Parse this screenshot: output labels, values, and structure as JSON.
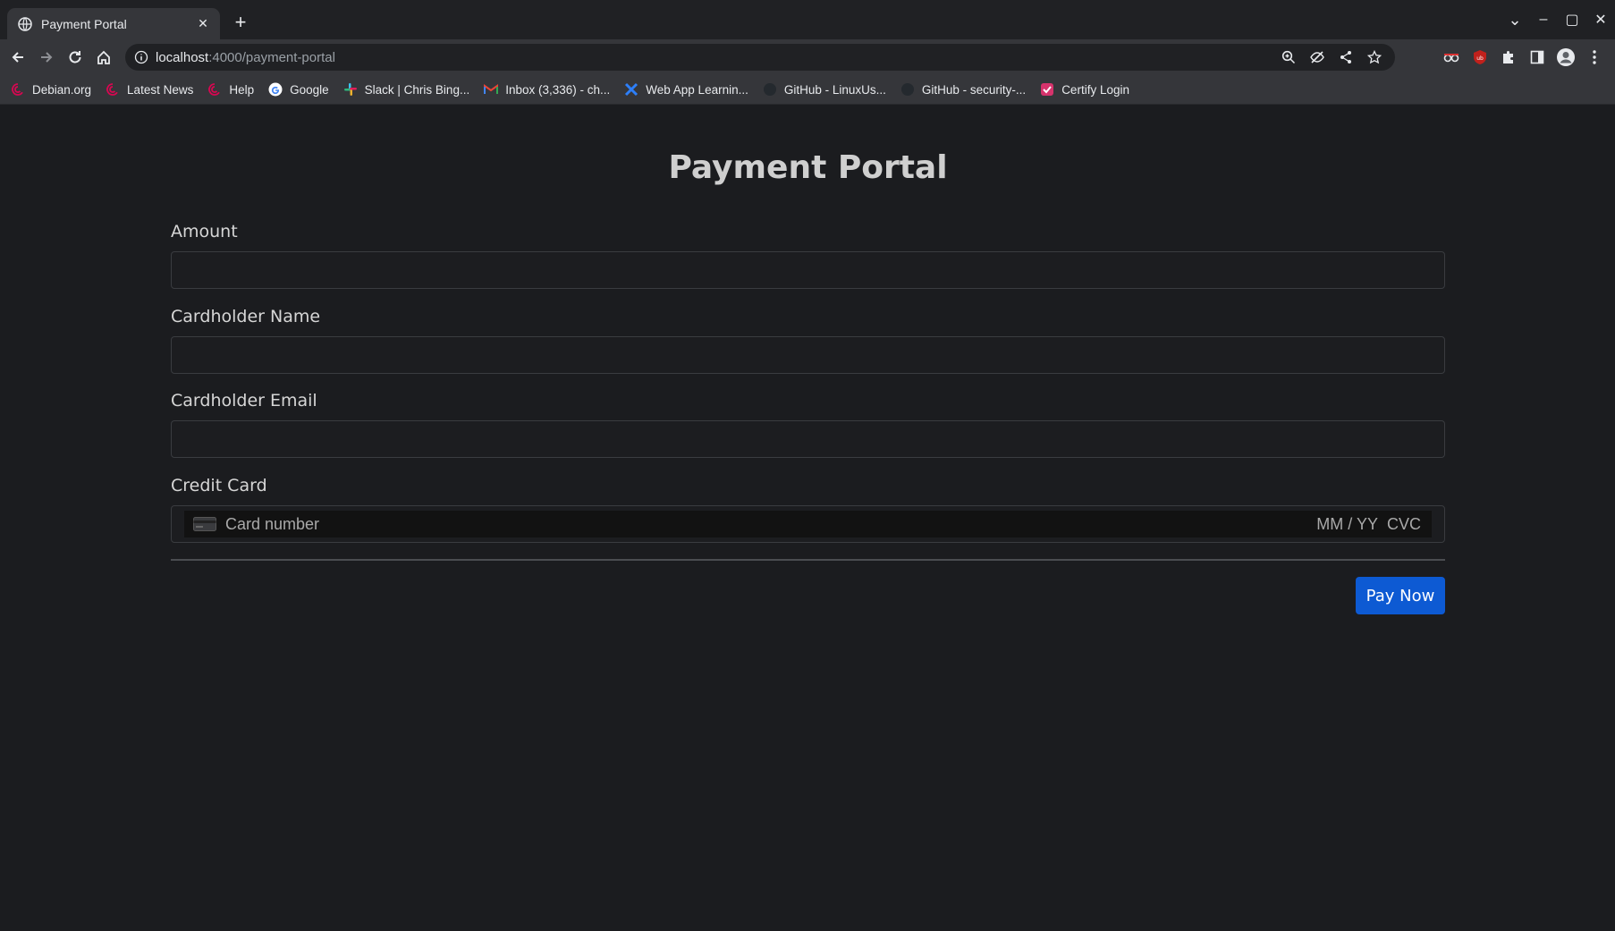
{
  "browser": {
    "tab": {
      "title": "Payment Portal",
      "close_glyph": "✕",
      "favicon": "globe-icon"
    },
    "new_tab_glyph": "+",
    "window_controls": {
      "tab_search": "⌄",
      "minimize": "–",
      "maximize": "▢",
      "close": "✕"
    },
    "address": {
      "host": "localhost",
      "path": ":4000/payment-portal"
    },
    "bookmarks": [
      {
        "label": "Debian.org",
        "icon": "debian-icon",
        "color": "#d70751"
      },
      {
        "label": "Latest News",
        "icon": "debian-icon",
        "color": "#d70751"
      },
      {
        "label": "Help",
        "icon": "debian-icon",
        "color": "#d70751"
      },
      {
        "label": "Google",
        "icon": "google-icon",
        "color": "#4285f4"
      },
      {
        "label": "Slack | Chris Bing...",
        "icon": "slack-icon",
        "color": "#e01e5a"
      },
      {
        "label": "Inbox (3,336) - ch...",
        "icon": "gmail-icon",
        "color": "#ea4335"
      },
      {
        "label": "Web App Learnin...",
        "icon": "web-app-icon",
        "color": "#2d7ff9"
      },
      {
        "label": "GitHub - LinuxUs...",
        "icon": "github-icon",
        "color": "#24292e"
      },
      {
        "label": "GitHub - security-...",
        "icon": "github-icon",
        "color": "#24292e"
      },
      {
        "label": "Certify Login",
        "icon": "certify-icon",
        "color": "#d6336c"
      }
    ]
  },
  "page": {
    "title": "Payment Portal",
    "fields": {
      "amount": {
        "label": "Amount",
        "value": ""
      },
      "name": {
        "label": "Cardholder Name",
        "value": ""
      },
      "email": {
        "label": "Cardholder Email",
        "value": ""
      }
    },
    "credit_card": {
      "label": "Credit Card",
      "number_placeholder": "Card number",
      "expiry_placeholder": "MM / YY",
      "cvc_placeholder": "CVC"
    },
    "pay_button": "Pay Now"
  },
  "colors": {
    "background": "#1b1c1f",
    "accent": "#0d5ad3"
  }
}
